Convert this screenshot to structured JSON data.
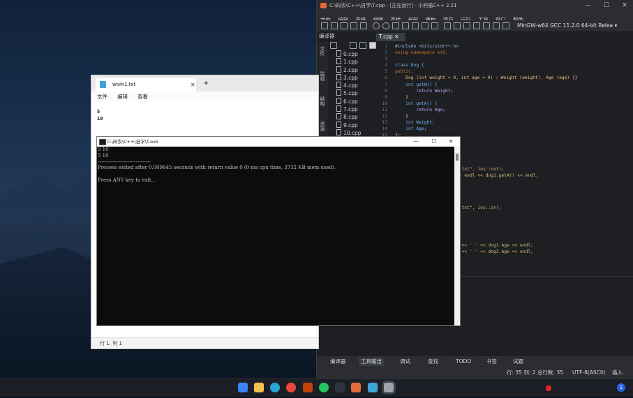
{
  "ide": {
    "title": "C:\\码农\\C++\\自学\\T.cpp - [正在运行] - 小熊猫C++ 2.21",
    "menu": [
      "文件",
      "编辑",
      "选择",
      "视图",
      "查找",
      "代码",
      "重构",
      "项目",
      "运行",
      "工具",
      "窗口",
      "帮助"
    ],
    "compiler": "MinGW-w64 GCC 11.2.0 64-bit Relea ▾",
    "panel_title": "编译器",
    "side_labels": [
      "文件",
      "监视",
      "结构",
      "资源"
    ],
    "files": [
      "0.cpp",
      "1.cpp",
      "2.cpp",
      "3.cpp",
      "4.cpp",
      "5.cpp",
      "6.cpp",
      "7.cpp",
      "8.cpp",
      "9.cpp",
      "10.cpp"
    ],
    "tab": "T.cpp ✕",
    "line_numbers": [
      "1",
      "2",
      "3",
      "4",
      "5",
      "6",
      "7",
      "8",
      "9",
      "10",
      "11",
      "12",
      "13",
      "14",
      "15"
    ],
    "code": [
      "#include <bits/stdc++.h>",
      "using namespace std;",
      "",
      "class Dog {",
      "public:",
      "    Dog (int weight = 0, int age = 0) : Weight (weight), Age (age) {}",
      "    int getW() {",
      "        return Weight;",
      "    }",
      "    int getA() {",
      "        return Age;",
      "    }",
      "    int Weight;",
      "    int Age;",
      "};"
    ],
    "code_tail": [
      "1.txt\", ios::out);",
      "<< endl << dog1.getA() << endl;",
      "",
      "",
      "",
      "",
      "1.txt\", ios::in);",
      "",
      "",
      "",
      "",
      "",
      "t << ' ' << dog1.Age << endl;",
      "t << ' ' << dog2.Age << endl;"
    ],
    "bottom_tabs": [
      "编译器",
      "工具输出",
      "调试",
      "查找",
      "TODO",
      "书签",
      "试题"
    ],
    "status_left": "行: 35 列: 2 总行数: 35",
    "status_enc": "UTF-8(ASCII)",
    "status_mode": "插入"
  },
  "notepad": {
    "tab_title": "work1.txt",
    "menu": [
      "文件",
      "编辑",
      "查看"
    ],
    "lines": [
      "5",
      "10"
    ],
    "status": "行 1, 列 1"
  },
  "console": {
    "title": "C:\\码农\\C++\\自学\\T.exe",
    "lines": [
      "5 10",
      "5 10",
      "--------------------------------",
      "Process exited after 0.009645 seconds with return value 0 (0 ms cpu time, 3732 KB mem used).",
      "",
      "Press ANY key to exit..."
    ]
  },
  "taskbar": {
    "badge": "1"
  }
}
